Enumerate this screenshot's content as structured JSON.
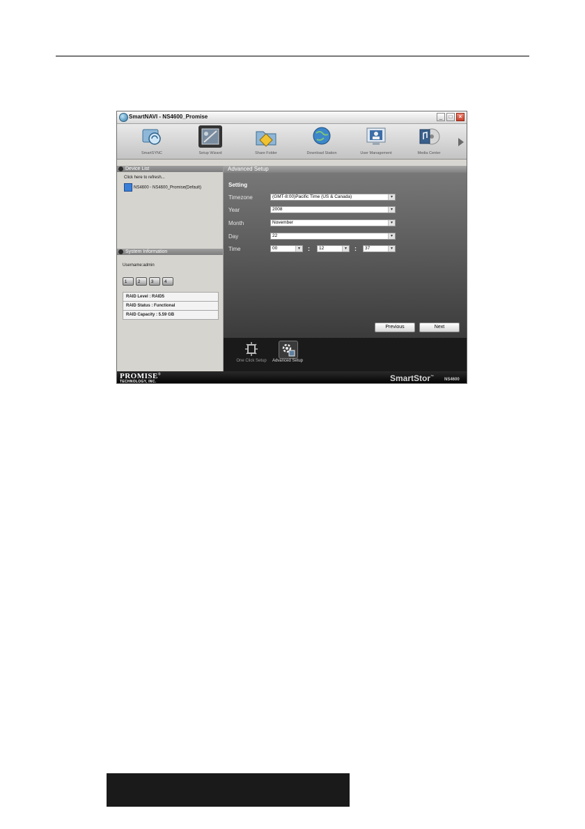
{
  "window": {
    "title": "SmartNAVI - NS4600_Promise"
  },
  "toolbar": {
    "items": [
      {
        "label": "SmartSYNC",
        "icon": "sync-icon"
      },
      {
        "label": "Setup Wizard",
        "icon": "wizard-icon"
      },
      {
        "label": "Share Folder",
        "icon": "folder-icon"
      },
      {
        "label": "Download Station",
        "icon": "globe-icon"
      },
      {
        "label": "User Management",
        "icon": "user-icon"
      },
      {
        "label": "Media Center",
        "icon": "media-icon"
      }
    ],
    "active_index": 1
  },
  "device_list": {
    "title": "Device List",
    "refresh": "Click here to refresh...",
    "device": "NS4600 - NS4600_Promise(Default)"
  },
  "system_info": {
    "title": "System Information",
    "username": "Username:admin",
    "disks": [
      "1",
      "2",
      "3",
      "4"
    ],
    "raid_level": "RAID Level : RAID5",
    "raid_status": "RAID Status : Functional",
    "raid_capacity": "RAID Capacity : 5.59 GB"
  },
  "main": {
    "header": "Advanced Setup",
    "section": "Setting",
    "timezone_label": "Timezone",
    "timezone_value": "(GMT-8:00)Pacific Time (US & Canada)",
    "year_label": "Year",
    "year_value": "2008",
    "month_label": "Month",
    "month_value": "November",
    "day_label": "Day",
    "day_value": "22",
    "time_label": "Time",
    "hour_value": "00",
    "minute_value": "12",
    "second_value": "37",
    "separator": ":",
    "previous": "Previous",
    "next": "Next"
  },
  "bottom_tabs": [
    {
      "label": "One Click Setup",
      "icon": "one-click-icon"
    },
    {
      "label": "Advanced Setup",
      "icon": "gear-icon"
    }
  ],
  "footer": {
    "brand": "PROMISE",
    "brand_mark": "®",
    "brand_sub": "TECHNOLOGY, INC.",
    "product": "SmartStor",
    "product_mark": "™",
    "model": "NS4600"
  }
}
